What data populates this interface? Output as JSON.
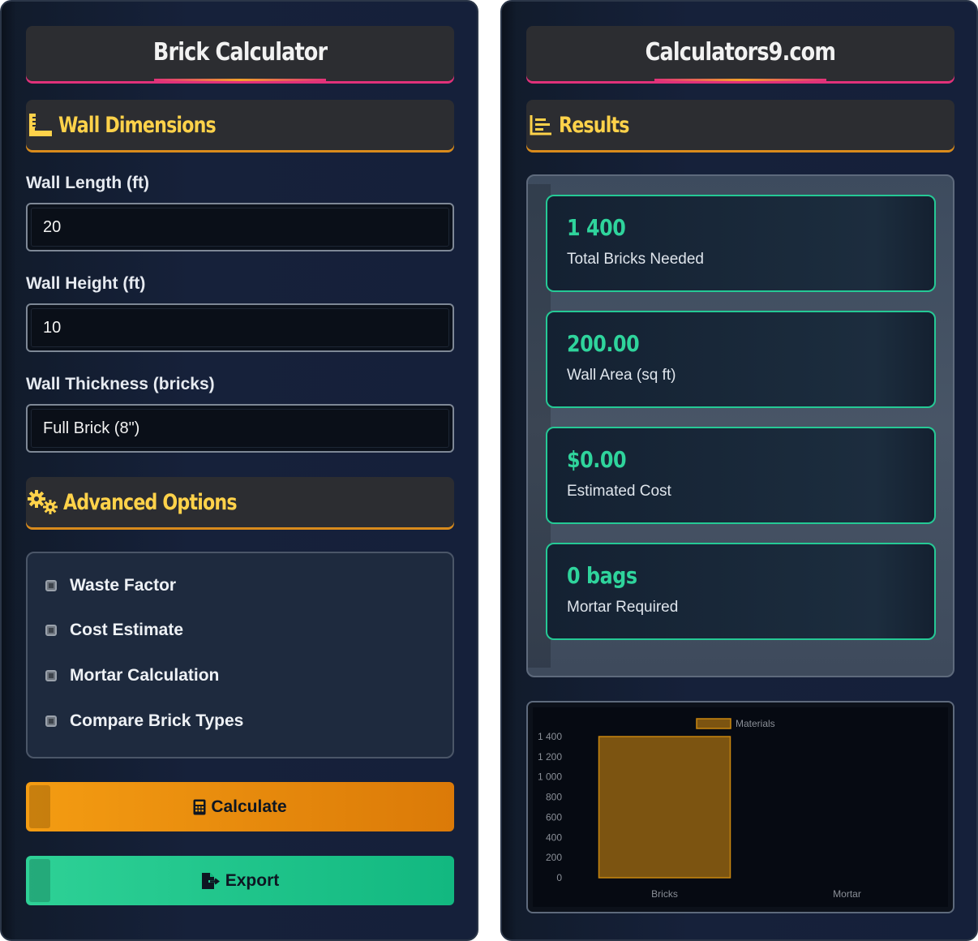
{
  "left": {
    "title": "Brick Calculator",
    "wall_section": {
      "title": "Wall Dimensions",
      "icon": "ruler-icon"
    },
    "fields": [
      {
        "label": "Wall Length (ft)",
        "value": "20"
      },
      {
        "label": "Wall Height (ft)",
        "value": "10"
      },
      {
        "label": "Wall Thickness (bricks)",
        "value": "Full Brick (8\")"
      }
    ],
    "advanced_section": {
      "title": "Advanced Options",
      "icon": "gears-icon"
    },
    "options": [
      {
        "label": "Waste Factor",
        "checked": false
      },
      {
        "label": "Cost Estimate",
        "checked": false
      },
      {
        "label": "Mortar Calculation",
        "checked": false
      },
      {
        "label": "Compare Brick Types",
        "checked": false
      }
    ],
    "buttons": {
      "calculate": {
        "label": "Calculate",
        "icon": "calculator-icon",
        "color": "#f39c12"
      },
      "export": {
        "label": "Export",
        "icon": "file-export-icon",
        "color": "#2ecc91"
      }
    }
  },
  "right": {
    "title": "Calculators9.com",
    "results_section": {
      "title": "Results",
      "icon": "bar-chart-icon"
    },
    "results": [
      {
        "value": "1 400",
        "label": "Total Bricks Needed"
      },
      {
        "value": "200.00",
        "label": "Wall Area (sq ft)"
      },
      {
        "value": "$0.00",
        "label": "Estimated Cost"
      },
      {
        "value": "0 bags",
        "label": "Mortar Required"
      }
    ]
  },
  "colors": {
    "accent_yellow": "#ffd24a",
    "accent_green": "#2fd49c",
    "accent_pink": "#e0317a",
    "bar_fill": "#7c5411",
    "bar_stroke": "#c8860f"
  },
  "chart_data": {
    "type": "bar",
    "categories": [
      "Bricks",
      "Mortar"
    ],
    "series": [
      {
        "name": "Materials",
        "values": [
          1400,
          0
        ]
      }
    ],
    "yticks": [
      "0",
      "200",
      "400",
      "600",
      "800",
      "1 000",
      "1 200",
      "1 400"
    ],
    "ylim": [
      0,
      1400
    ],
    "legend": "top-center",
    "grid": false
  }
}
